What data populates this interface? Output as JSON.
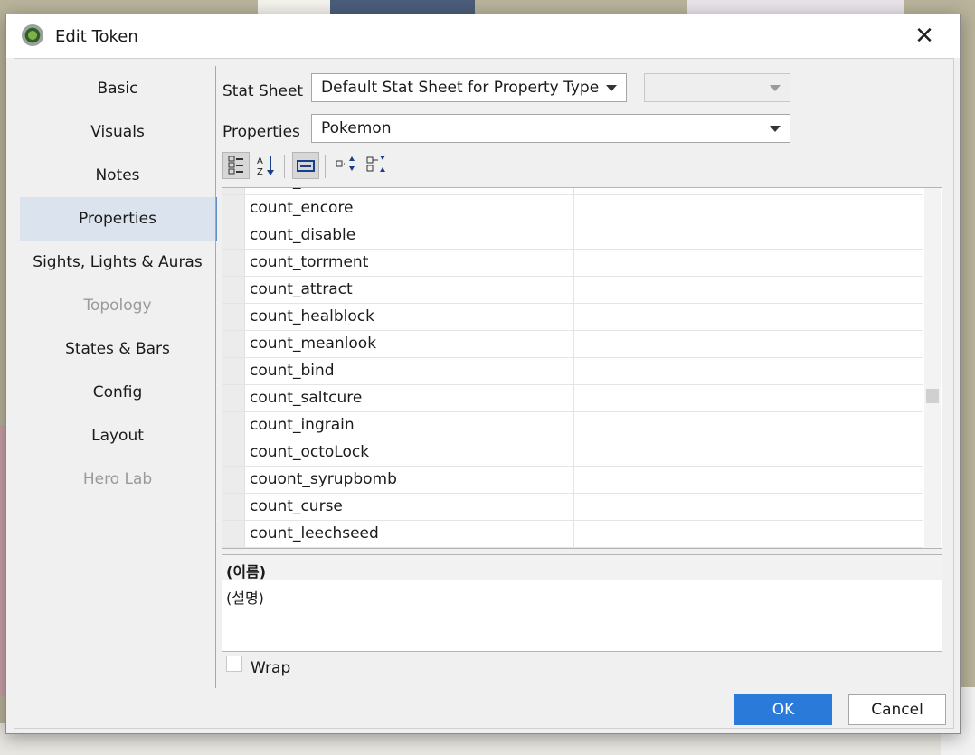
{
  "window": {
    "title": "Edit Token",
    "close_glyph": "✕"
  },
  "sidebar": {
    "items": [
      {
        "label": "Basic",
        "state": "normal"
      },
      {
        "label": "Visuals",
        "state": "normal"
      },
      {
        "label": "Notes",
        "state": "normal"
      },
      {
        "label": "Properties",
        "state": "active"
      },
      {
        "label": "Sights, Lights & Auras",
        "state": "normal"
      },
      {
        "label": "Topology",
        "state": "disabled"
      },
      {
        "label": "States & Bars",
        "state": "normal"
      },
      {
        "label": "Config",
        "state": "normal"
      },
      {
        "label": "Layout",
        "state": "normal"
      },
      {
        "label": "Hero Lab",
        "state": "disabled"
      }
    ]
  },
  "form": {
    "stat_sheet_label": "Stat Sheet",
    "stat_sheet_value": "Default Stat Sheet for Property Type",
    "stat_sheet_secondary_value": "",
    "properties_label": "Properties",
    "properties_value": "Pokemon"
  },
  "toolbar": {
    "buttons": [
      {
        "name": "categorized-view-icon",
        "pressed": true
      },
      {
        "name": "sort-alphabetical-icon",
        "pressed": false
      },
      {
        "name": "show-description-icon",
        "pressed": true
      },
      {
        "name": "expand-all-icon",
        "pressed": false
      },
      {
        "name": "collapse-all-icon",
        "pressed": false
      }
    ]
  },
  "property_table": {
    "partial_top_row": "count_taunt",
    "rows": [
      {
        "name": "count_encore",
        "value": ""
      },
      {
        "name": "count_disable",
        "value": ""
      },
      {
        "name": "count_torrment",
        "value": ""
      },
      {
        "name": "count_attract",
        "value": ""
      },
      {
        "name": "count_healblock",
        "value": ""
      },
      {
        "name": "count_meanlook",
        "value": ""
      },
      {
        "name": "count_bind",
        "value": ""
      },
      {
        "name": "count_saltcure",
        "value": ""
      },
      {
        "name": "count_ingrain",
        "value": ""
      },
      {
        "name": "count_octoLock",
        "value": ""
      },
      {
        "name": "couont_syrupbomb",
        "value": ""
      },
      {
        "name": "count_curse",
        "value": ""
      },
      {
        "name": "count_leechseed",
        "value": ""
      }
    ]
  },
  "description_panel": {
    "name": "(이름)",
    "text": "(설명)"
  },
  "wrap": {
    "label": "Wrap",
    "checked": false
  },
  "buttons": {
    "ok": "OK",
    "cancel": "Cancel"
  },
  "colors": {
    "accent": "#2a7ad9",
    "sidebar_active": "#dbe4ee"
  }
}
